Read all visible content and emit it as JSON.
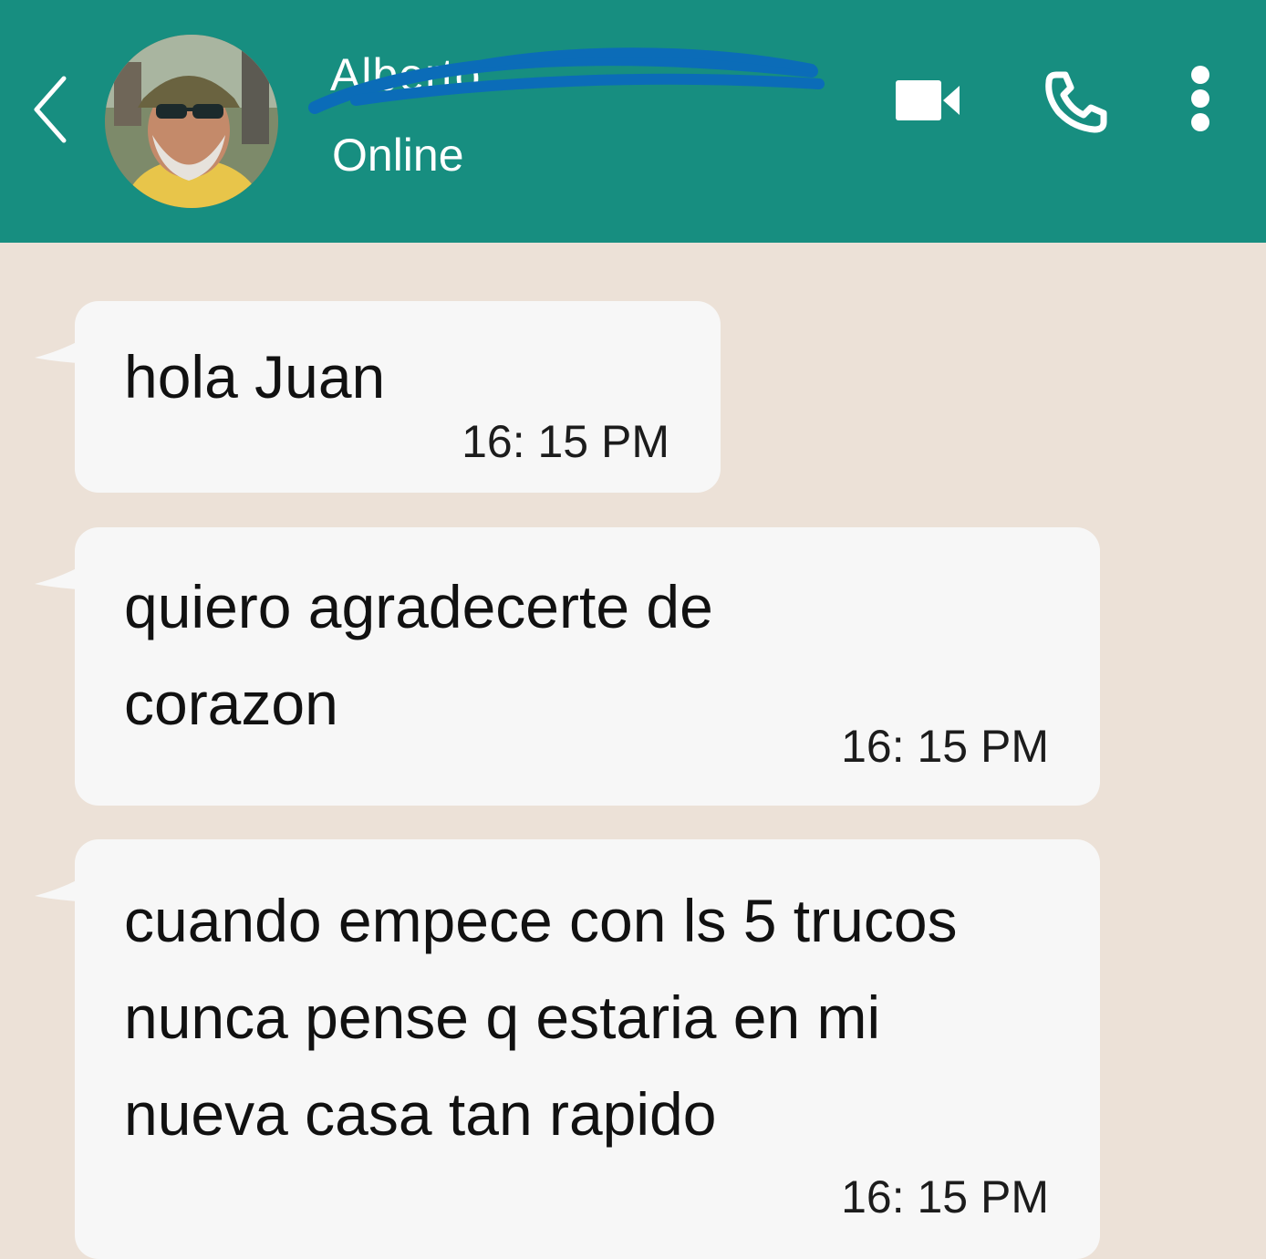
{
  "header": {
    "contact_name": "Alberto",
    "status": "Online",
    "bg_color": "#178e80"
  },
  "icons": {
    "back": "chevron-left-icon",
    "video": "video-camera-icon",
    "call": "phone-icon",
    "menu": "vertical-dots-icon"
  },
  "messages": [
    {
      "text": "hola Juan",
      "time": "16: 15 PM"
    },
    {
      "text": "quiero agradecerte de\ncorazon",
      "time": "16: 15 PM"
    },
    {
      "text": "cuando empece con ls 5 trucos\nnunca pense q estaria en mi\nnueva casa tan rapido",
      "time": "16: 15 PM"
    }
  ],
  "chat": {
    "background_color": "#ece1d7",
    "bubble_color": "#f7f7f7"
  }
}
